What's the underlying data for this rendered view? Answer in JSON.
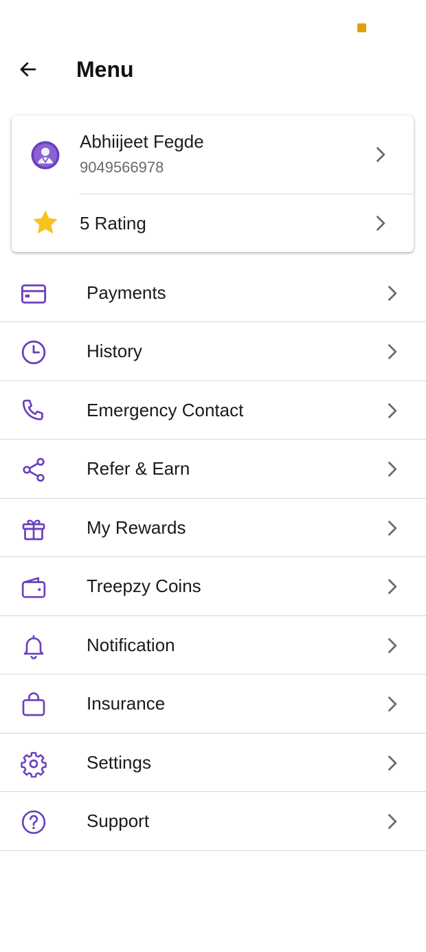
{
  "colors": {
    "accent": "#6a3fbf",
    "status_dot": "#e0a100",
    "star": "#f7c31d",
    "chevron": "#6b6b6b"
  },
  "header": {
    "title": "Menu",
    "back_icon": "arrow-left-icon"
  },
  "profile": {
    "name": "Abhiijeet Fegde",
    "phone": "9049566978",
    "avatar_icon": "user-avatar-icon",
    "rating_label": "5 Rating",
    "rating_icon": "star-icon"
  },
  "menu": {
    "items": [
      {
        "label": "Payments",
        "icon": "credit-card-icon"
      },
      {
        "label": "History",
        "icon": "clock-icon"
      },
      {
        "label": "Emergency Contact",
        "icon": "phone-icon"
      },
      {
        "label": "Refer & Earn",
        "icon": "share-icon"
      },
      {
        "label": "My Rewards",
        "icon": "gift-icon"
      },
      {
        "label": "Treepzy Coins",
        "icon": "wallet-icon"
      },
      {
        "label": "Notification",
        "icon": "bell-icon"
      },
      {
        "label": "Insurance",
        "icon": "bag-icon"
      },
      {
        "label": "Settings",
        "icon": "gear-icon"
      },
      {
        "label": "Support",
        "icon": "help-circle-icon"
      }
    ]
  }
}
